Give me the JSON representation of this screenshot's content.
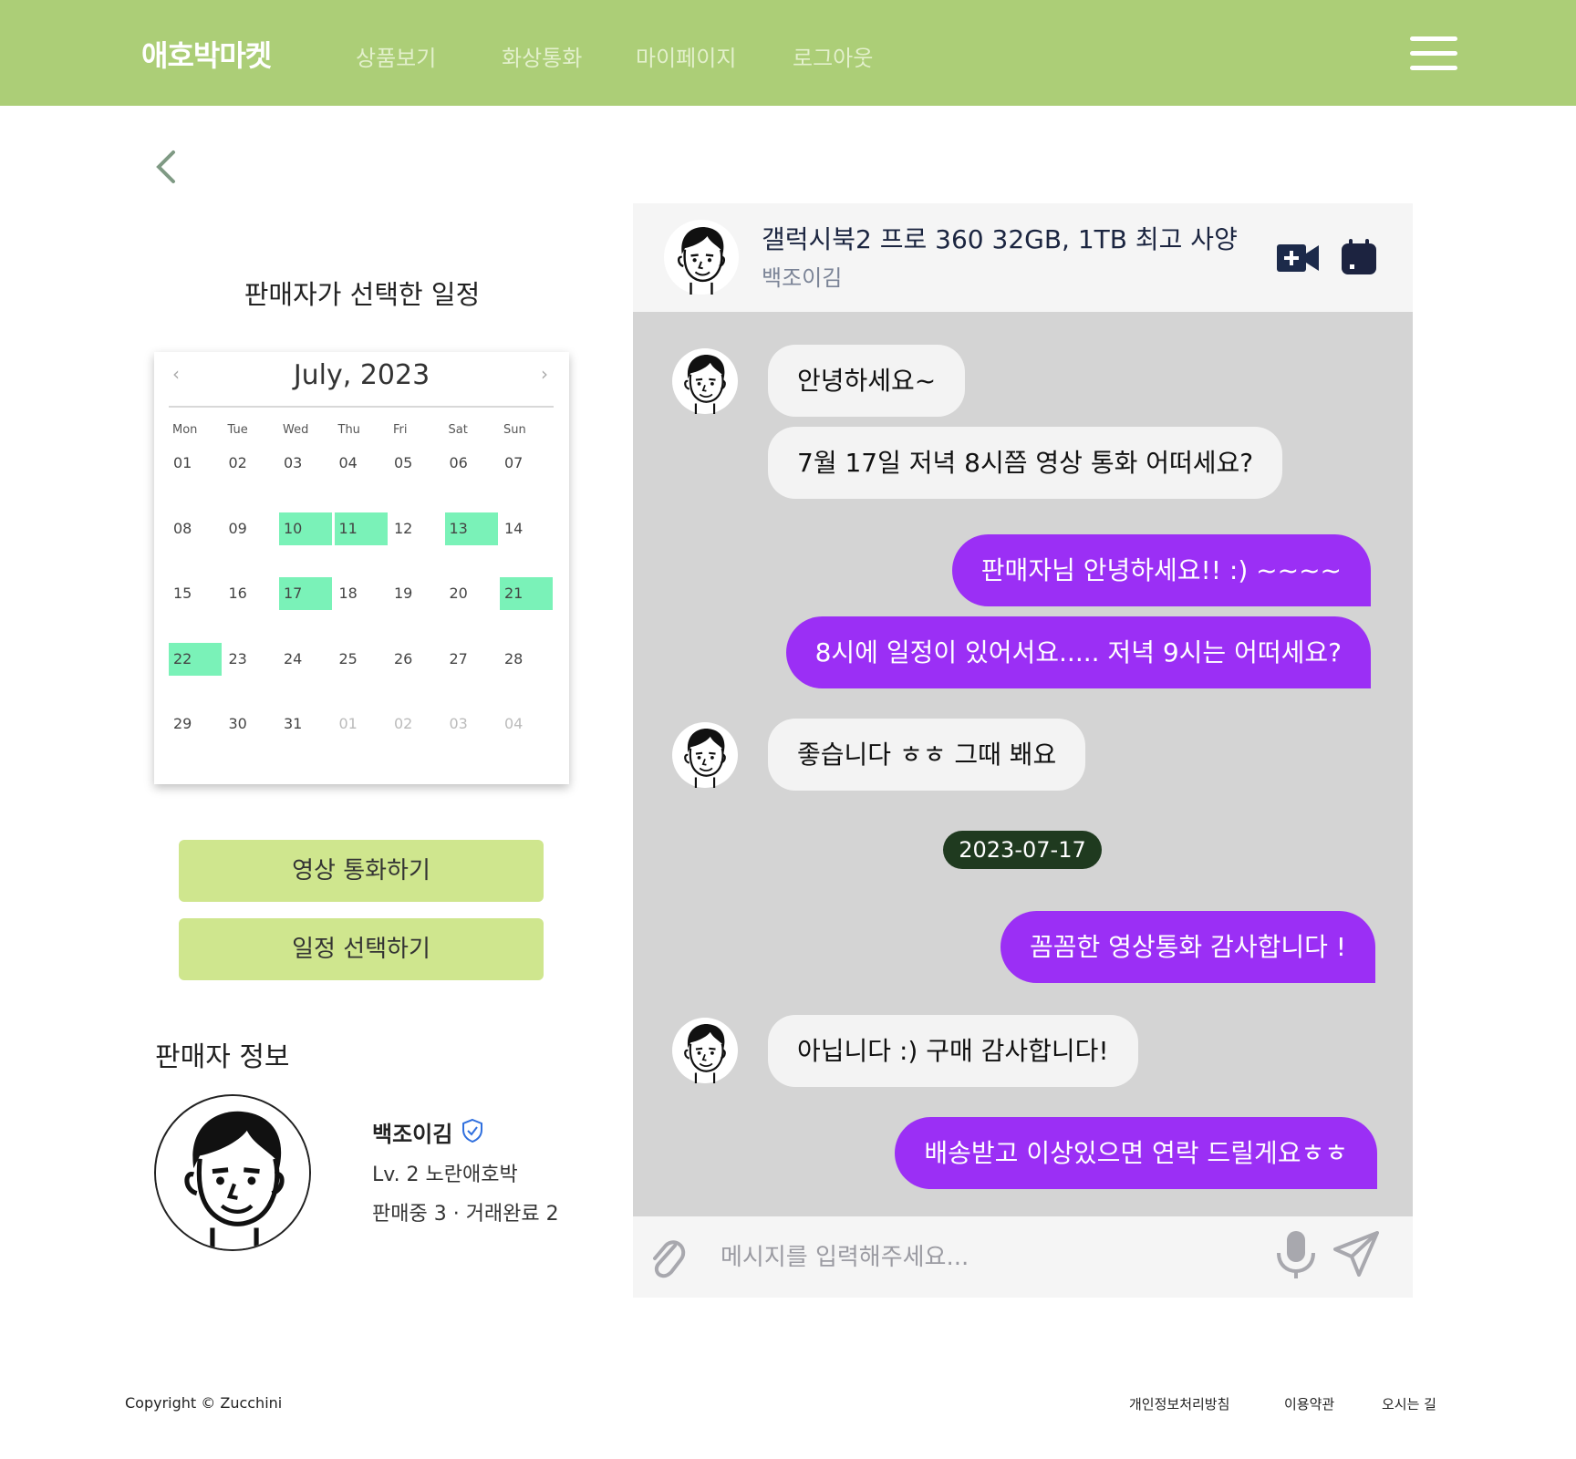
{
  "header": {
    "brand": "애호박마켓",
    "nav": [
      "상품보기",
      "화상통화",
      "마이페이지",
      "로그아웃"
    ]
  },
  "schedule": {
    "title": "판매자가 선택한 일정",
    "month": "July, 2023",
    "weekdays": [
      "Mon",
      "Tue",
      "Wed",
      "Thu",
      "Fri",
      "Sat",
      "Sun"
    ],
    "days": [
      [
        "01",
        "02",
        "03",
        "04",
        "05",
        "06",
        "07"
      ],
      [
        "08",
        "09",
        "10",
        "11",
        "12",
        "13",
        "14"
      ],
      [
        "15",
        "16",
        "17",
        "18",
        "19",
        "20",
        "21"
      ],
      [
        "22",
        "23",
        "24",
        "25",
        "26",
        "27",
        "28"
      ],
      [
        "29",
        "30",
        "31",
        "01",
        "02",
        "03",
        "04"
      ]
    ],
    "available_days": [
      "10",
      "11",
      "13",
      "17",
      "21",
      "22"
    ],
    "next_month_days": [
      "01",
      "02",
      "03",
      "04"
    ],
    "highlight_color": "#7af2b8"
  },
  "actions": {
    "video_call": "영상 통화하기",
    "select_schedule": "일정 선택하기"
  },
  "seller": {
    "section_title": "판매자 정보",
    "name": "백조이김",
    "level": "Lv. 2 노란애호박",
    "stats": "판매중 3 · 거래완료 2"
  },
  "chat": {
    "product_title": "갤럭시북2 프로 360 32GB, 1TB 최고 사양",
    "seller_name": "백조이김",
    "messages": [
      {
        "from": "seller",
        "text": "안녕하세요~"
      },
      {
        "from": "seller",
        "text": "7월 17일 저녁 8시쯤 영상 통화 어떠세요?"
      },
      {
        "from": "me",
        "text": "판매자님 안녕하세요!! :) ~~~~"
      },
      {
        "from": "me",
        "text": "8시에 일정이 있어서요.....  저녁 9시는 어떠세요?"
      },
      {
        "from": "seller",
        "text": "좋습니다 ㅎㅎ 그때 봬요"
      },
      {
        "from": "me",
        "text": "꼼꼼한 영상통화 감사합니다 !"
      },
      {
        "from": "seller",
        "text": "아닙니다 :) 구매 감사합니다!"
      },
      {
        "from": "me",
        "text": "배송받고 이상있으면 연락 드릴게요ㅎㅎ"
      }
    ],
    "date_divider": "2023-07-17",
    "input_placeholder": "메시지를 입력해주세요...",
    "my_bubble_color": "#9b2ff5"
  },
  "footer": {
    "copyright": "Copyright © Zucchini",
    "links": [
      "개인정보처리방침",
      "이용약관",
      "오시는 길"
    ]
  },
  "theme": {
    "header_bg": "#acce77",
    "button_bg": "#cfe68e"
  }
}
